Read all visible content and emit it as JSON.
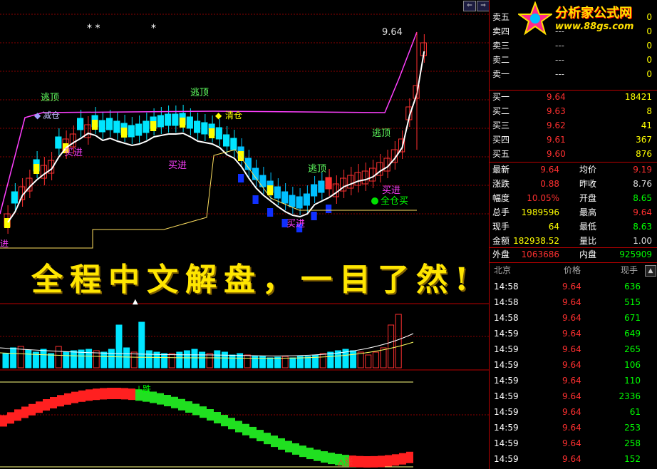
{
  "chart": {
    "price_label": "9.64",
    "markers": {
      "taoding1": "逃顶",
      "taoding2": "逃顶",
      "taoding3": "逃顶",
      "taoding4": "逃顶",
      "jiancang": "减仓",
      "qingcang": "清仓",
      "qingcang_sym": "◆",
      "jiancang_sym": "◆",
      "mairu1": "买进",
      "mairu2": "买进",
      "mairu3": "买进",
      "mairu4": "买进",
      "left_mai": "进",
      "left_edge": "进",
      "quancang": "全仓买",
      "stars": "* *",
      "star2": "*",
      "die": "↓跌",
      "zhang": "△涨",
      "tri": "▲"
    },
    "banner": "全程中文解盘，一目了然!",
    "colors": {
      "up": "#ff3030",
      "down": "#00e5ff",
      "ma": "#ffffff",
      "signal": "#ffff00",
      "purple": "#ff40ff"
    },
    "nav": {
      "left": "⇐",
      "right": "⇒"
    }
  },
  "logo": {
    "title": "分析家公式网",
    "url": "www.88gs.com"
  },
  "orderbook": {
    "asks": [
      {
        "label": "卖五",
        "price": "",
        "vol": "0"
      },
      {
        "label": "卖四",
        "price": "---",
        "vol": "0"
      },
      {
        "label": "卖三",
        "price": "---",
        "vol": "0"
      },
      {
        "label": "卖二",
        "price": "---",
        "vol": "0"
      },
      {
        "label": "卖一",
        "price": "---",
        "vol": "0"
      }
    ],
    "bids": [
      {
        "label": "买一",
        "price": "9.64",
        "vol": "18421"
      },
      {
        "label": "买二",
        "price": "9.63",
        "vol": "8"
      },
      {
        "label": "买三",
        "price": "9.62",
        "vol": "41"
      },
      {
        "label": "买四",
        "price": "9.61",
        "vol": "367"
      },
      {
        "label": "买五",
        "price": "9.60",
        "vol": "876"
      }
    ]
  },
  "quote": [
    {
      "l1": "最新",
      "v1": "9.64",
      "c1": "#ff3030",
      "l2": "均价",
      "v2": "9.19",
      "c2": "#ff3030"
    },
    {
      "l1": "涨跌",
      "v1": "0.88",
      "c1": "#ff3030",
      "l2": "昨收",
      "v2": "8.76",
      "c2": "#dddddd"
    },
    {
      "l1": "幅度",
      "v1": "10.05%",
      "c1": "#ff3030",
      "l2": "开盘",
      "v2": "8.65",
      "c2": "#00ff00"
    },
    {
      "l1": "总手",
      "v1": "1989596",
      "c1": "#ffff00",
      "l2": "最高",
      "v2": "9.64",
      "c2": "#ff3030"
    },
    {
      "l1": "现手",
      "v1": "64",
      "c1": "#ffff00",
      "l2": "最低",
      "v2": "8.63",
      "c2": "#00ff00"
    },
    {
      "l1": "金额",
      "v1": "182938.52",
      "c1": "#ffff00",
      "l2": "量比",
      "v2": "1.00",
      "c2": "#dddddd"
    }
  ],
  "inout": {
    "out_label": "外盘",
    "out_val": "1063686",
    "in_label": "内盘",
    "in_val": "925909"
  },
  "ticks_header": {
    "col1": "北京",
    "col2": "价格",
    "col3": "现手"
  },
  "ticks": [
    {
      "time": "14:58",
      "price": "9.64",
      "vol": "636"
    },
    {
      "time": "14:58",
      "price": "9.64",
      "vol": "515"
    },
    {
      "time": "14:58",
      "price": "9.64",
      "vol": "671"
    },
    {
      "time": "14:59",
      "price": "9.64",
      "vol": "649"
    },
    {
      "time": "14:59",
      "price": "9.64",
      "vol": "265"
    },
    {
      "time": "14:59",
      "price": "9.64",
      "vol": "106"
    },
    {
      "time": "14:59",
      "price": "9.64",
      "vol": "110"
    },
    {
      "time": "14:59",
      "price": "9.64",
      "vol": "2336"
    },
    {
      "time": "14:59",
      "price": "9.64",
      "vol": "61"
    },
    {
      "time": "14:59",
      "price": "9.64",
      "vol": "253"
    },
    {
      "time": "14:59",
      "price": "9.64",
      "vol": "258"
    },
    {
      "time": "14:59",
      "price": "9.64",
      "vol": "152"
    }
  ]
}
